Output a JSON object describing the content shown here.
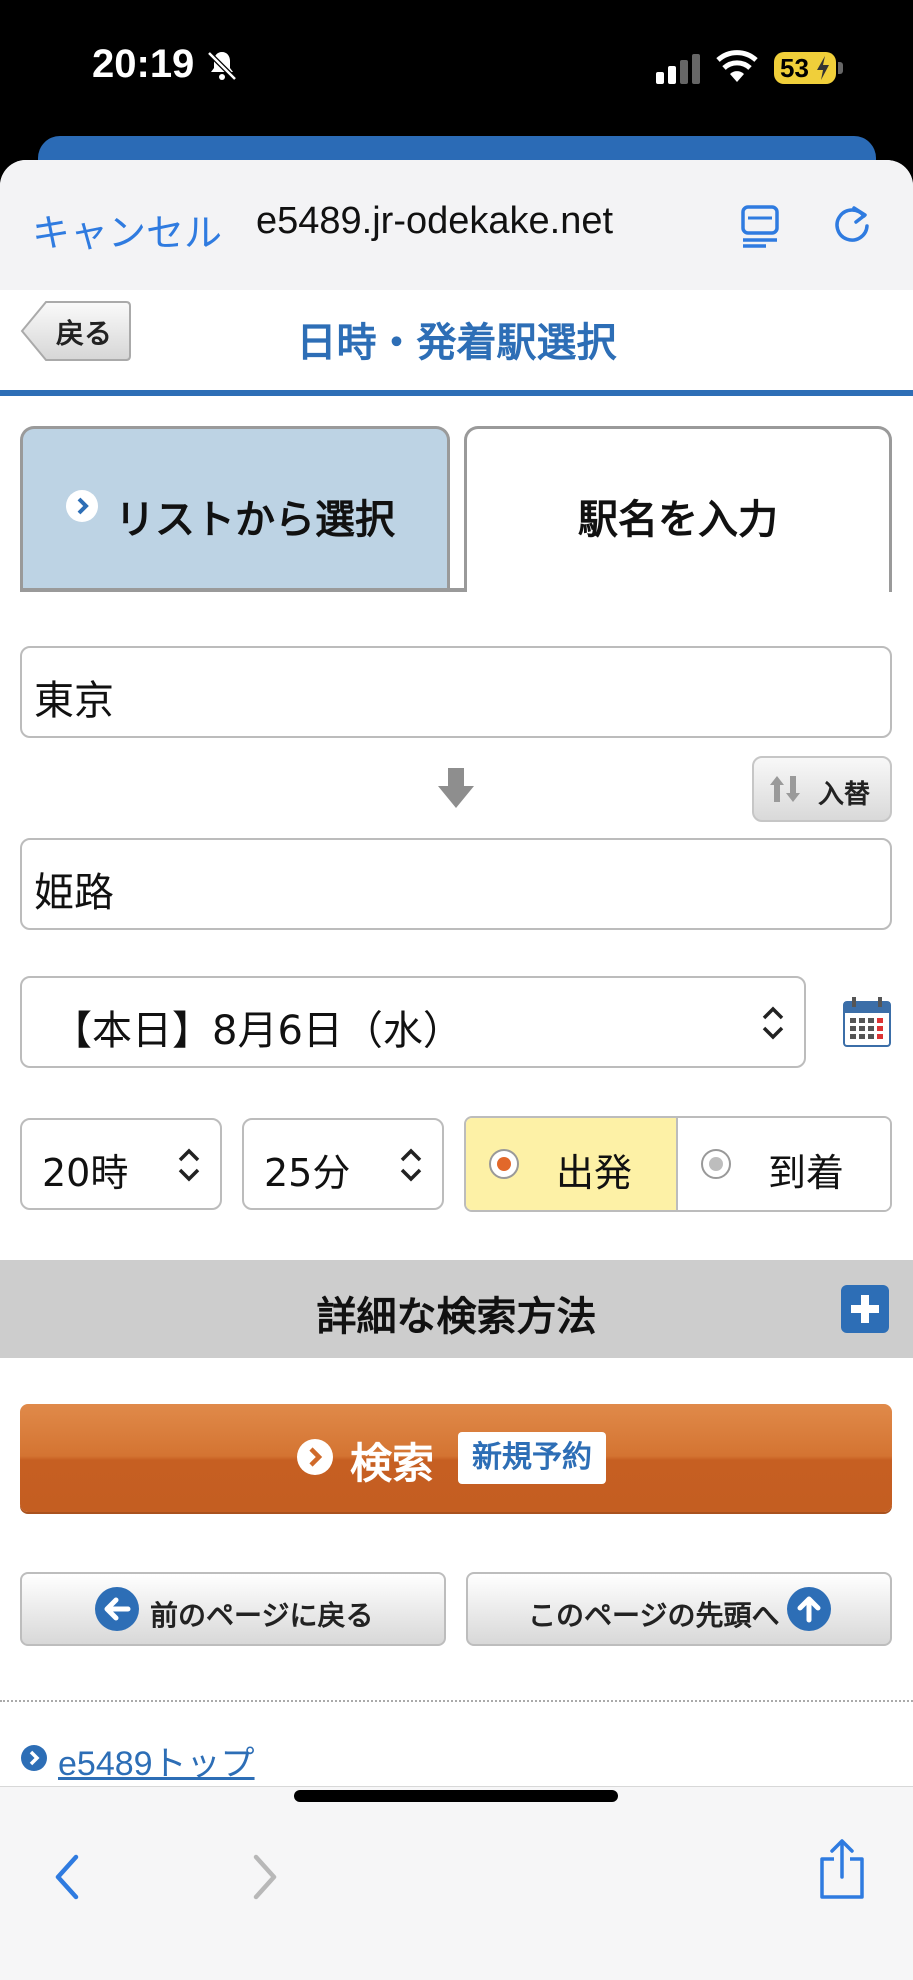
{
  "status_bar": {
    "time": "20:19",
    "battery": "53"
  },
  "browser": {
    "cancel_label": "キャンセル",
    "url": "e5489.jr-odekake.net"
  },
  "header": {
    "back_label": "戻る",
    "title": "日時・発着駅選択"
  },
  "tabs": [
    {
      "label": "リストから選択",
      "active": true
    },
    {
      "label": "駅名を入力",
      "active": false
    }
  ],
  "form": {
    "from_station": "東京",
    "to_station": "姫路",
    "swap_label": "入替",
    "date": "【本日】8月6日（水）",
    "hour": "20時",
    "minute": "25分",
    "departure_label": "出発",
    "arrival_label": "到着",
    "selected_mode": "出発"
  },
  "detail": {
    "label": "詳細な検索方法"
  },
  "search": {
    "label": "検索",
    "badge": "新規予約"
  },
  "nav": {
    "prev_label": "前のページに戻る",
    "top_label": "このページの先頭へ"
  },
  "footer": {
    "top_link": "e5489トップ"
  },
  "colors": {
    "brand_blue": "#2d6eb6",
    "search_orange": "#d06a2a",
    "selected_radio_bg": "#fdf1a6",
    "tab_active_bg": "#bdd3e4"
  }
}
